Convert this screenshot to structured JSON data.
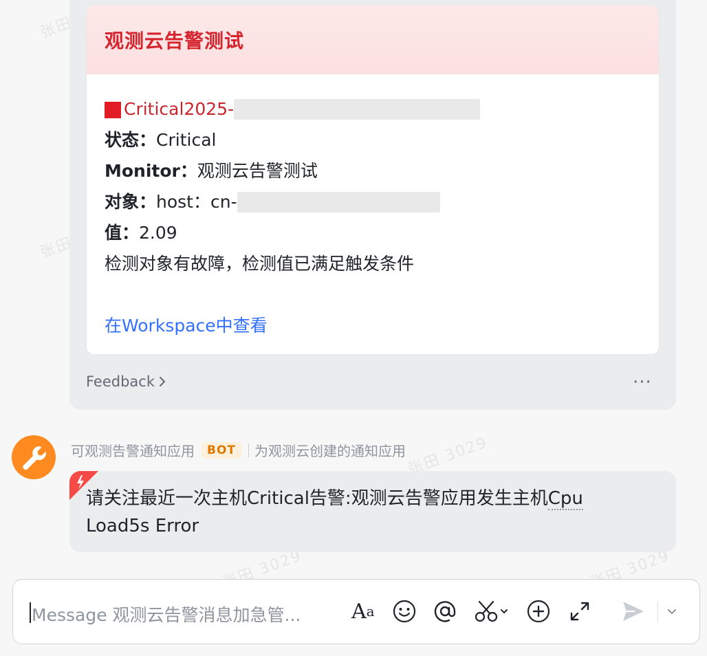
{
  "card": {
    "title": "观测云告警测试",
    "critical_line": "Critical2025-",
    "status_label": "状态：",
    "status_value": "Critical",
    "monitor_label": "Monitor：",
    "monitor_value": "观测云告警测试",
    "object_label": "对象：",
    "object_value": "host：cn-",
    "value_label": "值：",
    "value_value": "2.09",
    "description": "检测对象有故障，检测值已满足触发条件",
    "link": "在Workspace中查看"
  },
  "card_footer": {
    "feedback": "Feedback",
    "more": "···"
  },
  "bot_message": {
    "sender": "可观测告警通知应用",
    "badge": "BOT",
    "description": "为观测云创建的通知应用",
    "text_line1": "请关注最近一次主机Critical告警:观测云告警应用发生主机",
    "text_line1_tail": "Cpu",
    "text_line2": "Load5s Error"
  },
  "composer": {
    "placeholder": "Message 观测云告警消息加急管..."
  },
  "watermark": "张田 3029",
  "colors": {
    "critical": "#c9272d",
    "link": "#3370ff",
    "bot_badge": "#de7802",
    "avatar": "#ff8a1f"
  }
}
